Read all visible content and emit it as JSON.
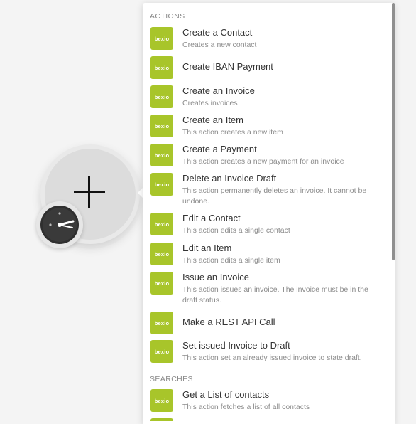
{
  "module": {
    "add_icon": "plus-icon",
    "trigger_icon": "clock-icon"
  },
  "brand": {
    "logo_text": "bexio",
    "logo_color": "#a8c52a"
  },
  "sections": {
    "actions_label": "ACTIONS",
    "searches_label": "SEARCHES"
  },
  "actions": [
    {
      "title": "Create a Contact",
      "desc": "Creates a new contact"
    },
    {
      "title": "Create IBAN Payment",
      "desc": ""
    },
    {
      "title": "Create an Invoice",
      "desc": "Creates invoices"
    },
    {
      "title": "Create an Item",
      "desc": "This action creates a new item"
    },
    {
      "title": "Create a Payment",
      "desc": "This action creates a new payment for an invoice"
    },
    {
      "title": "Delete an Invoice Draft",
      "desc": "This action permanently deletes an invoice. It cannot be undone."
    },
    {
      "title": "Edit a Contact",
      "desc": "This action edits a single contact"
    },
    {
      "title": "Edit an Item",
      "desc": "This action edits a single item"
    },
    {
      "title": "Issue an Invoice",
      "desc": "This action issues an invoice. The invoice must be in the draft status."
    },
    {
      "title": "Make a REST API Call",
      "desc": ""
    },
    {
      "title": "Set issued Invoice to Draft",
      "desc": "This action set an already issued invoice to state draft."
    }
  ],
  "searches": [
    {
      "title": "Get a List of contacts",
      "desc": "This action fetches a list of all contacts"
    }
  ]
}
